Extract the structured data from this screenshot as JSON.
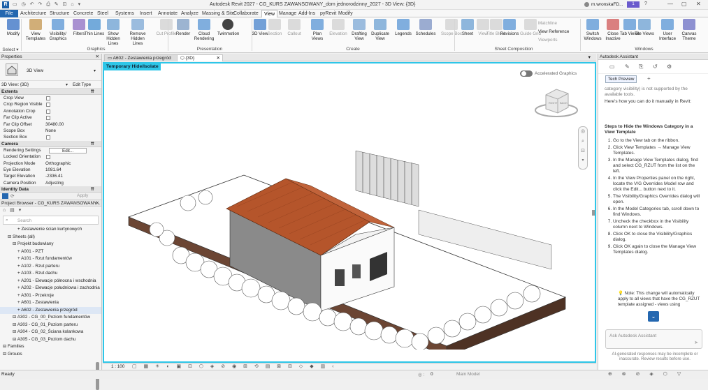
{
  "titlebar": {
    "app_title": "Autodesk Revit 2027 - CG_KURS ZAWANSOWANY_dom jednorodzinny_2027 - 3D View: {3D}",
    "user": "m.wronskaFD...",
    "notif": "1"
  },
  "menu": {
    "items": [
      "File",
      "Architecture",
      "Structure",
      "Concrete",
      "Steel",
      "Systems",
      "Insert",
      "Annotate",
      "Analyze",
      "Massing & Site",
      "Collaborate",
      "View",
      "Manage",
      "Add-Ins",
      "pyRevit",
      "Modify"
    ],
    "active": "View"
  },
  "ribbon": {
    "buttons": [
      {
        "label": "Modify",
        "name": "modify-button"
      },
      {
        "label": "View Templates",
        "name": "view-templates-button"
      },
      {
        "label": "Visibility/ Graphics",
        "name": "visibility-graphics-button"
      },
      {
        "label": "Filters",
        "name": "filters-button"
      },
      {
        "label": "Thin Lines",
        "name": "thin-lines-button"
      },
      {
        "label": "Show Hidden Lines",
        "name": "show-hidden-lines-button"
      },
      {
        "label": "Remove Hidden Lines",
        "name": "remove-hidden-lines-button"
      },
      {
        "label": "Cut Profile",
        "name": "cut-profile-button"
      },
      {
        "label": "Render",
        "name": "render-button"
      },
      {
        "label": "Cloud Rendering",
        "name": "cloud-rendering-button"
      },
      {
        "label": "Twinmotion",
        "name": "twinmotion-button"
      },
      {
        "label": "3D View",
        "name": "3d-view-button"
      },
      {
        "label": "Section",
        "name": "section-button"
      },
      {
        "label": "Callout",
        "name": "callout-button"
      },
      {
        "label": "Plan Views",
        "name": "plan-views-button"
      },
      {
        "label": "Elevation",
        "name": "elevation-button"
      },
      {
        "label": "Drafting View",
        "name": "drafting-view-button"
      },
      {
        "label": "Duplicate View",
        "name": "duplicate-view-button"
      },
      {
        "label": "Legends",
        "name": "legends-button"
      },
      {
        "label": "Schedules",
        "name": "schedules-button"
      },
      {
        "label": "Scope Box",
        "name": "scope-box-button"
      },
      {
        "label": "Sheet",
        "name": "sheet-button"
      },
      {
        "label": "View",
        "name": "view-button"
      },
      {
        "label": "Title Block",
        "name": "title-block-button"
      },
      {
        "label": "Revisions",
        "name": "revisions-button"
      },
      {
        "label": "Guide Grid",
        "name": "guide-grid-button"
      },
      {
        "label": "Switch Windows",
        "name": "switch-windows-button"
      },
      {
        "label": "Close Inactive",
        "name": "close-inactive-button"
      },
      {
        "label": "Tab Views",
        "name": "tab-views-button"
      },
      {
        "label": "Tile Views",
        "name": "tile-views-button"
      },
      {
        "label": "User Interface",
        "name": "user-interface-button"
      },
      {
        "label": "Canvas Theme",
        "name": "canvas-theme-button"
      }
    ],
    "small": [
      "Matchline",
      "View Reference",
      "Viewports"
    ],
    "groups": [
      "Select ▾",
      "Graphics",
      "Presentation",
      "Create",
      "Sheet Composition",
      "Windows"
    ]
  },
  "properties": {
    "header": "Properties",
    "type_name": "3D View",
    "selector": "3D View: {3D}",
    "edit_type": "Edit Type",
    "sections": {
      "extents": "Extents",
      "camera": "Camera",
      "identity": "Identity Data"
    },
    "extents": [
      {
        "label": "Crop View",
        "check": true
      },
      {
        "label": "Crop Region Visible",
        "check": true
      },
      {
        "label": "Annotation Crop",
        "check": true
      },
      {
        "label": "Far Clip Active",
        "check": true
      },
      {
        "label": "Far Clip Offset",
        "value": "30480.00"
      },
      {
        "label": "Scope Box",
        "value": "None"
      },
      {
        "label": "Section Box",
        "check": true
      }
    ],
    "camera": [
      {
        "label": "Rendering Settings",
        "value": "Edit..."
      },
      {
        "label": "Locked Orientation",
        "check": true
      },
      {
        "label": "Projection Mode",
        "value": "Orthographic"
      },
      {
        "label": "Eye Elevation",
        "value": "1081.64"
      },
      {
        "label": "Target Elevation",
        "value": "-2336.41"
      },
      {
        "label": "Camera Position",
        "value": "Adjusting"
      }
    ],
    "apply": "Apply"
  },
  "browser": {
    "header": "Project Browser - CG_KURS ZAWANSOWANY...",
    "search_placeholder": "Search",
    "items": [
      {
        "text": "Zestawienie ścian kurtynowych",
        "indent": 3
      },
      {
        "text": "Sheets (all)",
        "indent": 1
      },
      {
        "text": "Projekt budowlany",
        "indent": 2
      },
      {
        "text": "A001 - PZT",
        "indent": 3
      },
      {
        "text": "A101 - Rzut fundamentów",
        "indent": 3
      },
      {
        "text": "A102 - Rzut parteru",
        "indent": 3
      },
      {
        "text": "A103 - Rzut dachu",
        "indent": 3
      },
      {
        "text": "A201 - Elewacje północna i wschodnia",
        "indent": 3
      },
      {
        "text": "A202 - Elewacje południowa i zachodnia",
        "indent": 3
      },
      {
        "text": "A301 - Przekroje",
        "indent": 3
      },
      {
        "text": "A601 - Zestawienia",
        "indent": 3
      },
      {
        "text": "A602 - Zestawienia przegród",
        "indent": 3
      },
      {
        "text": "A302 - CG_00_Poziom fundamentów",
        "indent": 2
      },
      {
        "text": "A303 - CG_01_Poziom parteru",
        "indent": 2
      },
      {
        "text": "A304 - CG_02_Ściana kolankowa",
        "indent": 2
      },
      {
        "text": "A305 - CG_03_Poziom dachu",
        "indent": 2
      },
      {
        "text": "Families",
        "indent": 0
      },
      {
        "text": "Groups",
        "indent": 0
      }
    ]
  },
  "doc_tabs": [
    {
      "label": "A602 - Zestawienia przegród"
    },
    {
      "label": "{3D}"
    }
  ],
  "viewport": {
    "temp_label": "Temporary Hide/Isolate",
    "accel_label": "Accelerated Graphics",
    "scale": "1 : 100"
  },
  "assistant": {
    "header": "Autodesk Assistant",
    "tech_preview": "Tech Preview",
    "intro_cut": "category visibility) is not supported by the available tools.",
    "intro": "Here's how you can do it manually in Revit:",
    "heading": "Steps to Hide the Windows Category in a View Template",
    "steps": [
      "Go to the View tab on the ribbon.",
      "Click View Templates → Manage View Templates.",
      "In the Manage View Templates dialog, find and select CG_RZUT from the list on the left.",
      "In the View Properties panel on the right, locate the V/G Overrides Model row and click the Edit... button next to it.",
      "The Visibility/Graphics Overrides dialog will open.",
      "In the Model Categories tab, scroll down to find Windows.",
      "Uncheck the checkbox in the Visibility column next to Windows.",
      "Click OK to close the Visibility/Graphics dialog.",
      "Click OK again to close the Manage View Templates dialog."
    ],
    "note": "Note: This change will automatically apply to all views that have the CG_RZUT template assigned - views using",
    "input_placeholder": "Ask Autodesk Assistant",
    "disclaimer": "AI-generated responses may be incomplete or inaccurate. Review results before use."
  },
  "status": {
    "ready": "Ready",
    "model": "Main Model",
    "zero": "0"
  },
  "colors": {
    "accent": "#2467b0",
    "viewport_border": "#2ec6e8",
    "temp_label_bg": "#2ec6e8",
    "roof": "#b5552b",
    "ground": "#5b3a2a"
  }
}
